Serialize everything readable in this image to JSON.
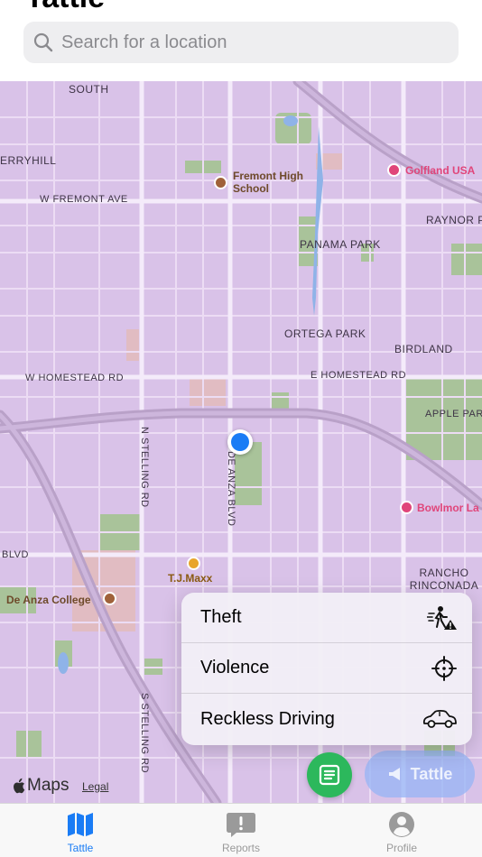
{
  "header": {
    "app_title": "Tattle",
    "search_placeholder": "Search for a location"
  },
  "map": {
    "labels": {
      "south": "SOUTH",
      "erryhill": "ERRYHILL",
      "w_fremont_ave": "W FREMONT AVE",
      "raynor_p": "RAYNOR P",
      "panama_park": "PANAMA PARK",
      "ortega_park": "ORTEGA PARK",
      "birdland": "BIRDLAND",
      "w_homestead_rd": "W HOMESTEAD RD",
      "e_homestead_rd": "E HOMESTEAD RD",
      "apple_park": "APPLE PARK",
      "n_stelling_rd": "N STELLING RD",
      "de_anza_blvd": "DE ANZA BLVD",
      "blvd": "BLVD",
      "rancho_rinconada": "RANCHO RINCONADA",
      "s_stelling_rd": "S STELLING RD"
    },
    "pois": {
      "fremont_high": "Fremont High School",
      "golfland": "Golfland USA",
      "bowlmor": "Bowlmor La",
      "tj_maxx": "T.J.Maxx",
      "de_anza_college": "De Anza College"
    },
    "brand": "Maps",
    "legal": "Legal"
  },
  "report_menu": {
    "items": [
      {
        "label": "Theft",
        "icon": "person-warning-icon"
      },
      {
        "label": "Violence",
        "icon": "crosshair-icon"
      },
      {
        "label": "Reckless Driving",
        "icon": "car-icon"
      }
    ]
  },
  "tattle_button": {
    "label": "Tattle"
  },
  "tabbar": {
    "tabs": [
      {
        "label": "Tattle",
        "icon": "map-icon",
        "active": true
      },
      {
        "label": "Reports",
        "icon": "exclamation-bubble-icon",
        "active": false
      },
      {
        "label": "Profile",
        "icon": "person-circle-icon",
        "active": false
      }
    ]
  },
  "colors": {
    "accent": "#1a7cf5",
    "fab_green": "#2cb85c",
    "map_base": "#d9c2e8"
  }
}
